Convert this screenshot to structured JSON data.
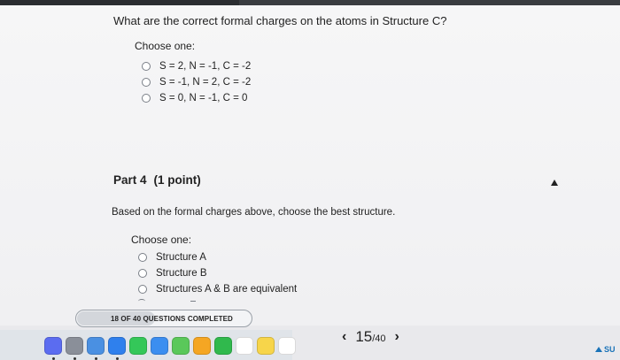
{
  "question1": {
    "prompt": "What are the correct formal charges on the atoms in Structure C?",
    "choose_label": "Choose one:",
    "options": [
      "S = 2, N = -1, C = -2",
      "S = -1, N = 2, C = -2",
      "S = 0, N = -1, C = 0"
    ]
  },
  "part4": {
    "title": "Part 4",
    "points": "(1 point)",
    "prompt": "Based on the formal charges above, choose the best structure.",
    "choose_label": "Choose one:",
    "options": [
      "Structure A",
      "Structure B",
      "Structures A & B are equivalent"
    ]
  },
  "progress": {
    "label": "18 OF 40 QUESTIONS COMPLETED",
    "completed": 18,
    "total": 40
  },
  "pager": {
    "prev_icon": "chevron-left-icon",
    "next_icon": "chevron-right-icon",
    "prev": "‹",
    "next": "›",
    "current": "15",
    "total": "/40"
  },
  "submit_label": "SU",
  "dock": {
    "icons": [
      {
        "name": "siri-icon",
        "color": "#5b6cf0"
      },
      {
        "name": "launchpad-icon",
        "color": "#8a8f99"
      },
      {
        "name": "finder-icon",
        "color": "#4a90e2"
      },
      {
        "name": "safari-icon",
        "color": "#2f80ed"
      },
      {
        "name": "messages-icon",
        "color": "#34c759"
      },
      {
        "name": "mail-icon",
        "color": "#3b8ef0"
      },
      {
        "name": "maps-icon",
        "color": "#5ac85a"
      },
      {
        "name": "photos-icon",
        "color": "#f5a623"
      },
      {
        "name": "facetime-icon",
        "color": "#30b94d"
      },
      {
        "name": "calendar-icon",
        "color": "#ffffff"
      },
      {
        "name": "notes-icon",
        "color": "#f7d54a"
      },
      {
        "name": "reminders-icon",
        "color": "#ffffff"
      }
    ]
  }
}
